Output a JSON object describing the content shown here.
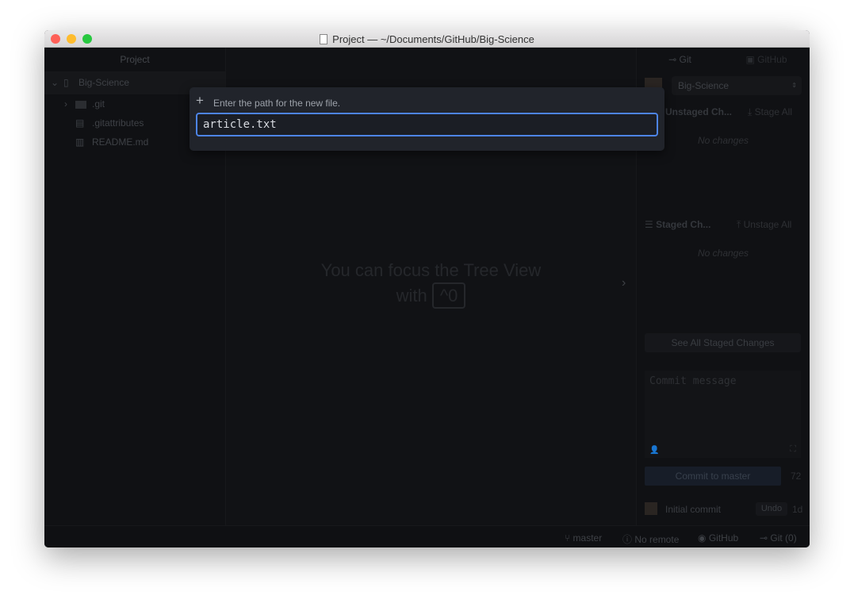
{
  "window": {
    "title": "Project — ~/Documents/GitHub/Big-Science"
  },
  "tree": {
    "header": "Project",
    "root": "Big-Science",
    "items": [
      {
        "label": ".git",
        "icon": "folder-icon"
      },
      {
        "label": ".gitattributes",
        "icon": "file-text-icon"
      },
      {
        "label": "README.md",
        "icon": "book-icon"
      }
    ]
  },
  "center": {
    "hint_line1": "You can focus the Tree View",
    "hint_line2": "with",
    "shortcut": "^0"
  },
  "modal": {
    "prompt": "Enter the path for the new file.",
    "value": "article.txt"
  },
  "git": {
    "tab_git": "Git",
    "tab_github": "GitHub",
    "repo": "Big-Science",
    "unstaged_title": "Unstaged Ch...",
    "stage_all": "Stage All",
    "unstaged_empty": "No changes",
    "staged_title": "Staged Ch...",
    "unstage_all": "Unstage All",
    "staged_empty": "No changes",
    "see_all": "See All Staged Changes",
    "commit_placeholder": "Commit message",
    "commit_button": "Commit to master",
    "char_count": "72",
    "last_commit": "Initial commit",
    "undo": "Undo",
    "age": "1d"
  },
  "status": {
    "branch": "master",
    "remote": "No remote",
    "github": "GitHub",
    "git": "Git (0)"
  },
  "colors": {
    "accent": "#4d84e6"
  }
}
